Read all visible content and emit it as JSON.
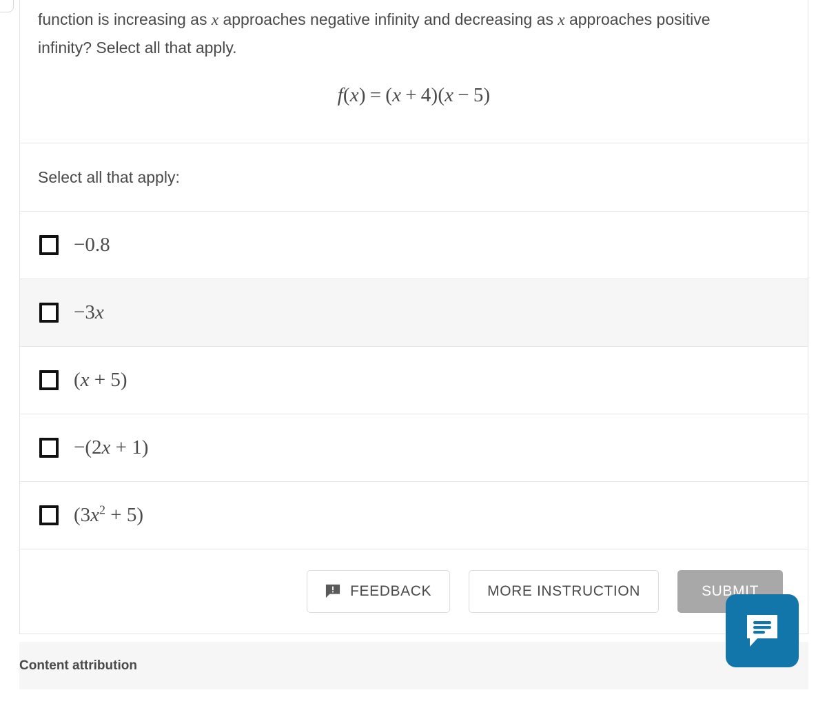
{
  "question": {
    "text_line1": "function is increasing as ",
    "var1": "x",
    "text_line2": " approaches negative infinity and decreasing as ",
    "var2": "x",
    "text_line3": " approaches positive infinity? Select all that apply.",
    "formula": {
      "fx": "f",
      "fx_arg_open": "(",
      "fx_var": "x",
      "fx_arg_close": ")",
      "equals": "=",
      "factor1_open": "(",
      "factor1_var": "x",
      "factor1_op": "+",
      "factor1_num": "4",
      "factor1_close": ")",
      "factor2_open": "(",
      "factor2_var": "x",
      "factor2_op": "−",
      "factor2_num": "5",
      "factor2_close": ")",
      "plain": "f(x) = (x + 4)(x − 5)"
    }
  },
  "select_prompt": "Select all that apply:",
  "options": [
    {
      "id": "opt-1",
      "label": "−0.8",
      "checked": false,
      "highlighted": false
    },
    {
      "id": "opt-2",
      "label": "−3x",
      "checked": false,
      "highlighted": true
    },
    {
      "id": "opt-3",
      "label": "(x + 5)",
      "checked": false,
      "highlighted": false
    },
    {
      "id": "opt-4",
      "label": "−(2x + 1)",
      "checked": false,
      "highlighted": false
    },
    {
      "id": "opt-5",
      "label": "(3x² + 5)",
      "checked": false,
      "highlighted": false
    }
  ],
  "actions": {
    "feedback_label": "FEEDBACK",
    "more_instruction_label": "MORE INSTRUCTION",
    "submit_label": "SUBMIT",
    "submit_disabled": true
  },
  "footer": {
    "attribution": "Content attribution"
  },
  "chat_widget": {
    "icon": "chat-bubble-icon",
    "color": "#1276ab"
  },
  "colors": {
    "text": "#4a4a4a",
    "border": "#e6e6e6",
    "row_highlight": "#f6f6f6",
    "footer_bg": "#f6f6f6",
    "submit_disabled_bg": "#a8a8a8",
    "chat_blue": "#1276ab"
  }
}
